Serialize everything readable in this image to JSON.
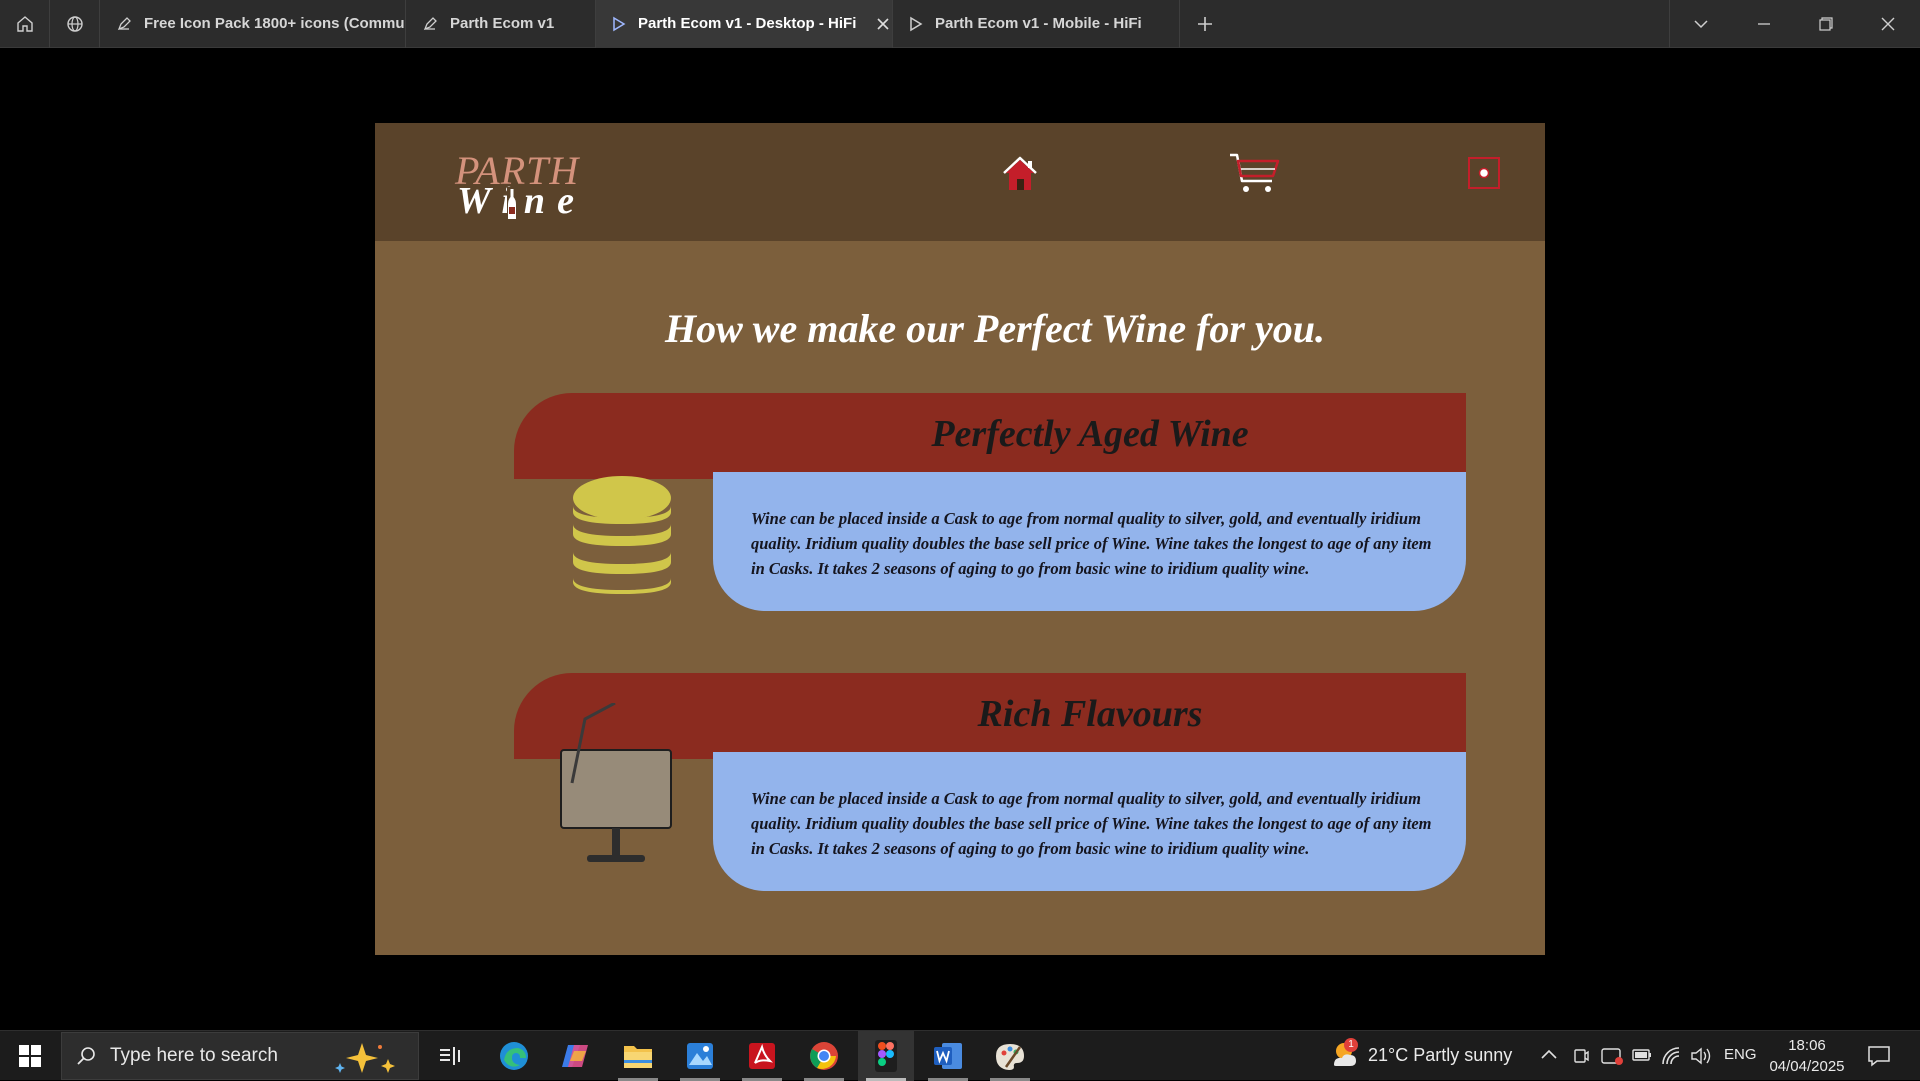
{
  "tabs": [
    {
      "label": "Free Icon Pack 1800+ icons (Commun",
      "icon": "draft-icon"
    },
    {
      "label": "Parth Ecom v1",
      "icon": "draft-icon"
    },
    {
      "label": "Parth Ecom v1 - Desktop - HiFi",
      "icon": "play-icon",
      "active": true
    },
    {
      "label": "Parth Ecom v1 - Mobile - HiFi",
      "icon": "play-icon"
    }
  ],
  "site": {
    "logo_top": "PARTH",
    "logo_bottom": "Wine",
    "headline": "How we make our Perfect Wine for you.",
    "features": [
      {
        "title": "Perfectly Aged Wine",
        "body": "Wine can be placed inside a Cask to age from normal quality to silver, gold, and eventually iridium quality. Iridium quality doubles the base sell price of Wine. Wine takes the longest to age of any item in Casks. It takes 2 seasons of aging to go from basic wine to iridium quality wine.",
        "icon": "coin-stack-icon"
      },
      {
        "title": "Rich Flavours",
        "body": "Wine can be placed inside a Cask to age from normal quality to silver, gold, and eventually iridium quality. Iridium quality doubles the base sell price of Wine. Wine takes the longest to age of any item in Casks. It takes 2 seasons of aging to go from basic wine to iridium quality wine.",
        "icon": "drink-glass-icon"
      }
    ]
  },
  "taskbar": {
    "search_placeholder": "Type here to search",
    "weather": "21°C  Partly sunny",
    "language": "ENG",
    "time": "18:06",
    "date": "04/04/2025",
    "weather_badge": "1"
  },
  "colors": {
    "header_bg": "#5a432a",
    "page_bg": "#7c5f3c",
    "banner": "#8b2b1f",
    "card_body": "#93b4ec",
    "accent_red": "#c41e2a"
  }
}
